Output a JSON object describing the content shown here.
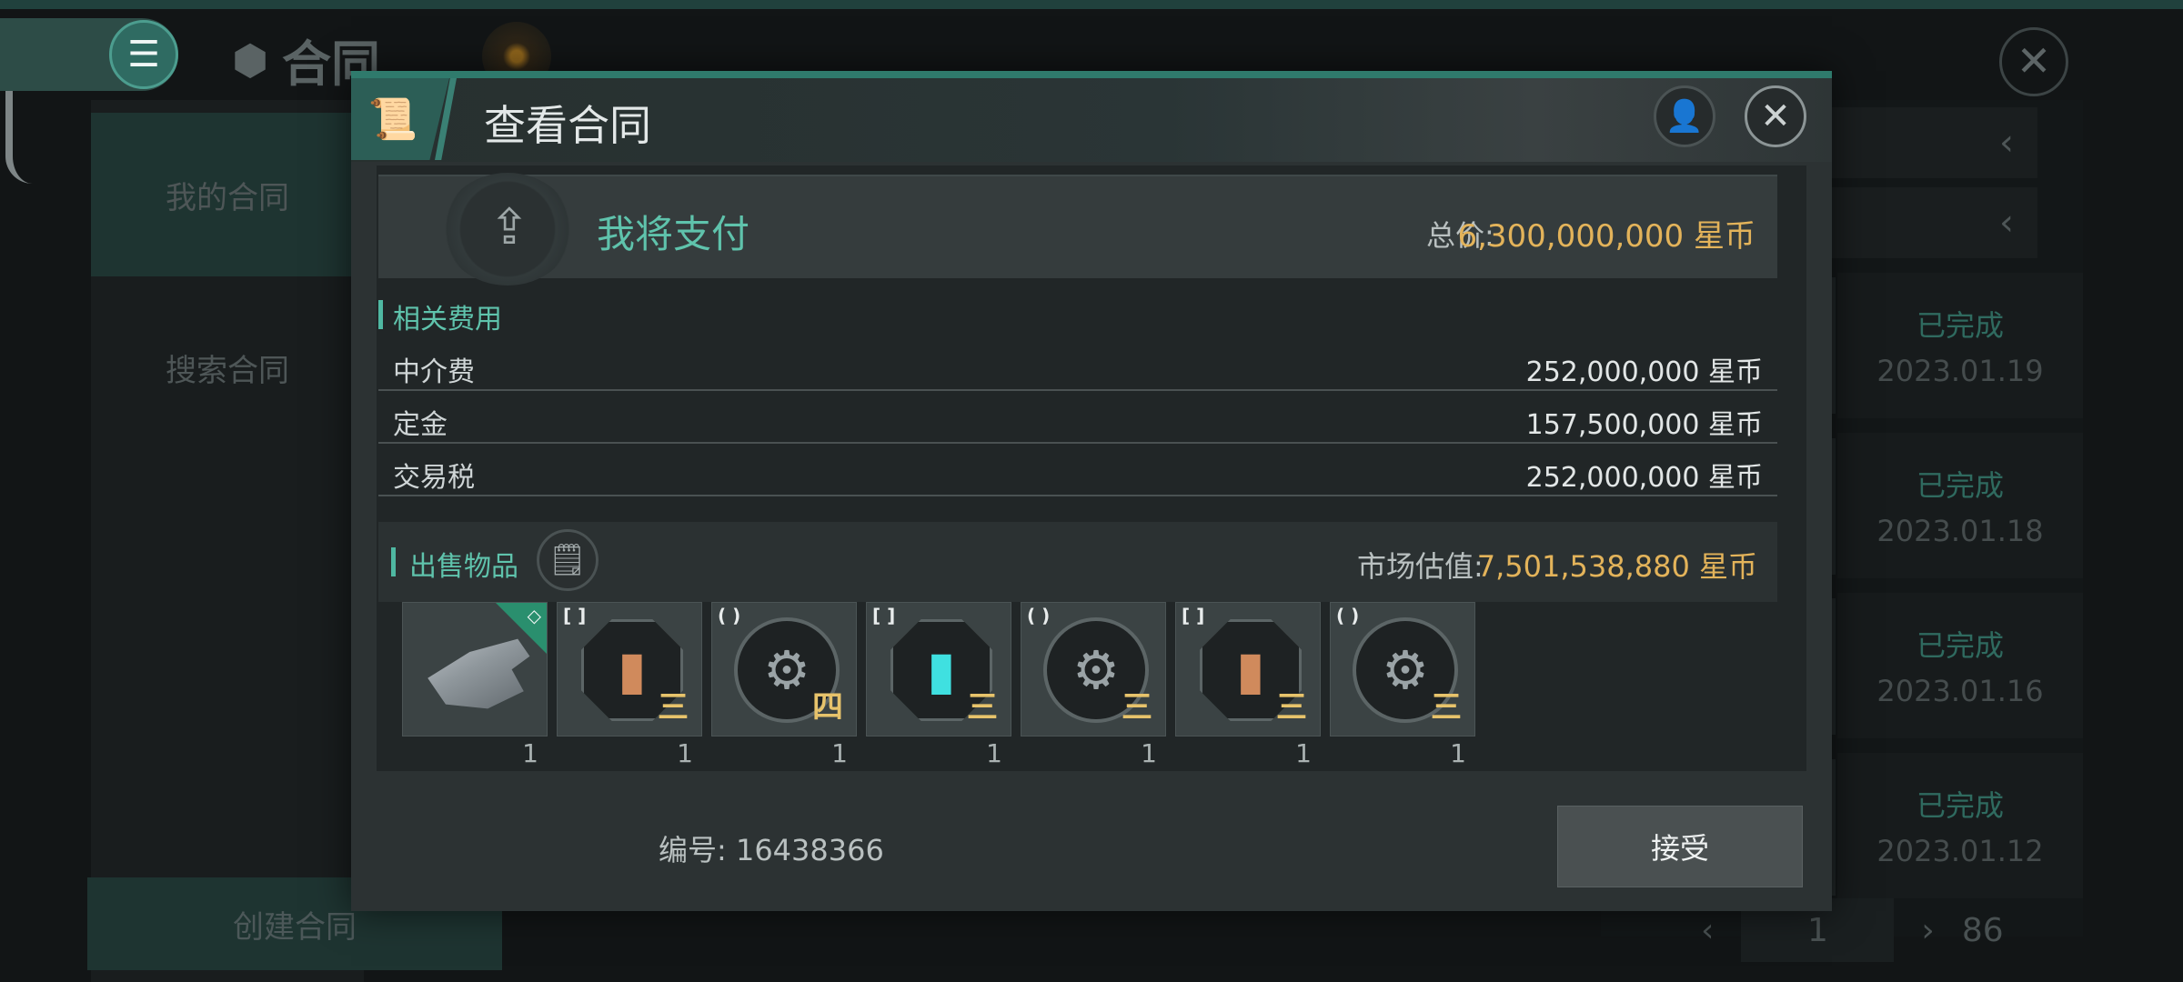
{
  "background": {
    "title": "合同",
    "nav": [
      {
        "label": "我的合同"
      },
      {
        "label": "搜索合同"
      }
    ],
    "create_label": "创建合同",
    "rows": [
      {
        "status": "已完成",
        "date": "2023.01.19"
      },
      {
        "status": "已完成",
        "date": "2023.01.18"
      },
      {
        "status": "已完成",
        "date": "2023.01.16"
      },
      {
        "status": "已完成",
        "date": "2023.01.12"
      }
    ],
    "pager": {
      "page": "1",
      "total": "86"
    }
  },
  "modal": {
    "title": "查看合同",
    "pay_label": "我将支付",
    "total_label": "总价:",
    "total_value": "6,300,000,000 星币",
    "fees_title": "相关费用",
    "fees": [
      {
        "label": "中介费",
        "value": "252,000,000 星币"
      },
      {
        "label": "定金",
        "value": "157,500,000 星币"
      },
      {
        "label": "交易税",
        "value": "252,000,000 星币"
      }
    ],
    "items_title": "出售物品",
    "market_label": "市场估值:",
    "market_value": "7,501,538,880 星币",
    "items": [
      {
        "kind": "ship",
        "tier": "",
        "bracket": "",
        "qty": "1"
      },
      {
        "kind": "canister-copper",
        "tier": "三",
        "bracket": "[ ]",
        "qty": "1"
      },
      {
        "kind": "turret",
        "tier": "四",
        "bracket": "( )",
        "qty": "1"
      },
      {
        "kind": "canister-cyan",
        "tier": "三",
        "bracket": "[ ]",
        "qty": "1"
      },
      {
        "kind": "turret",
        "tier": "三",
        "bracket": "( )",
        "qty": "1"
      },
      {
        "kind": "canister-copper",
        "tier": "三",
        "bracket": "[ ]",
        "qty": "1"
      },
      {
        "kind": "turret",
        "tier": "三",
        "bracket": "( )",
        "qty": "1"
      }
    ],
    "id_text": "编号: 16438366",
    "accept_label": "接受"
  },
  "colors": {
    "accent": "#5fc3ac",
    "gold": "#e3b35a",
    "panel": "#2c3233"
  }
}
